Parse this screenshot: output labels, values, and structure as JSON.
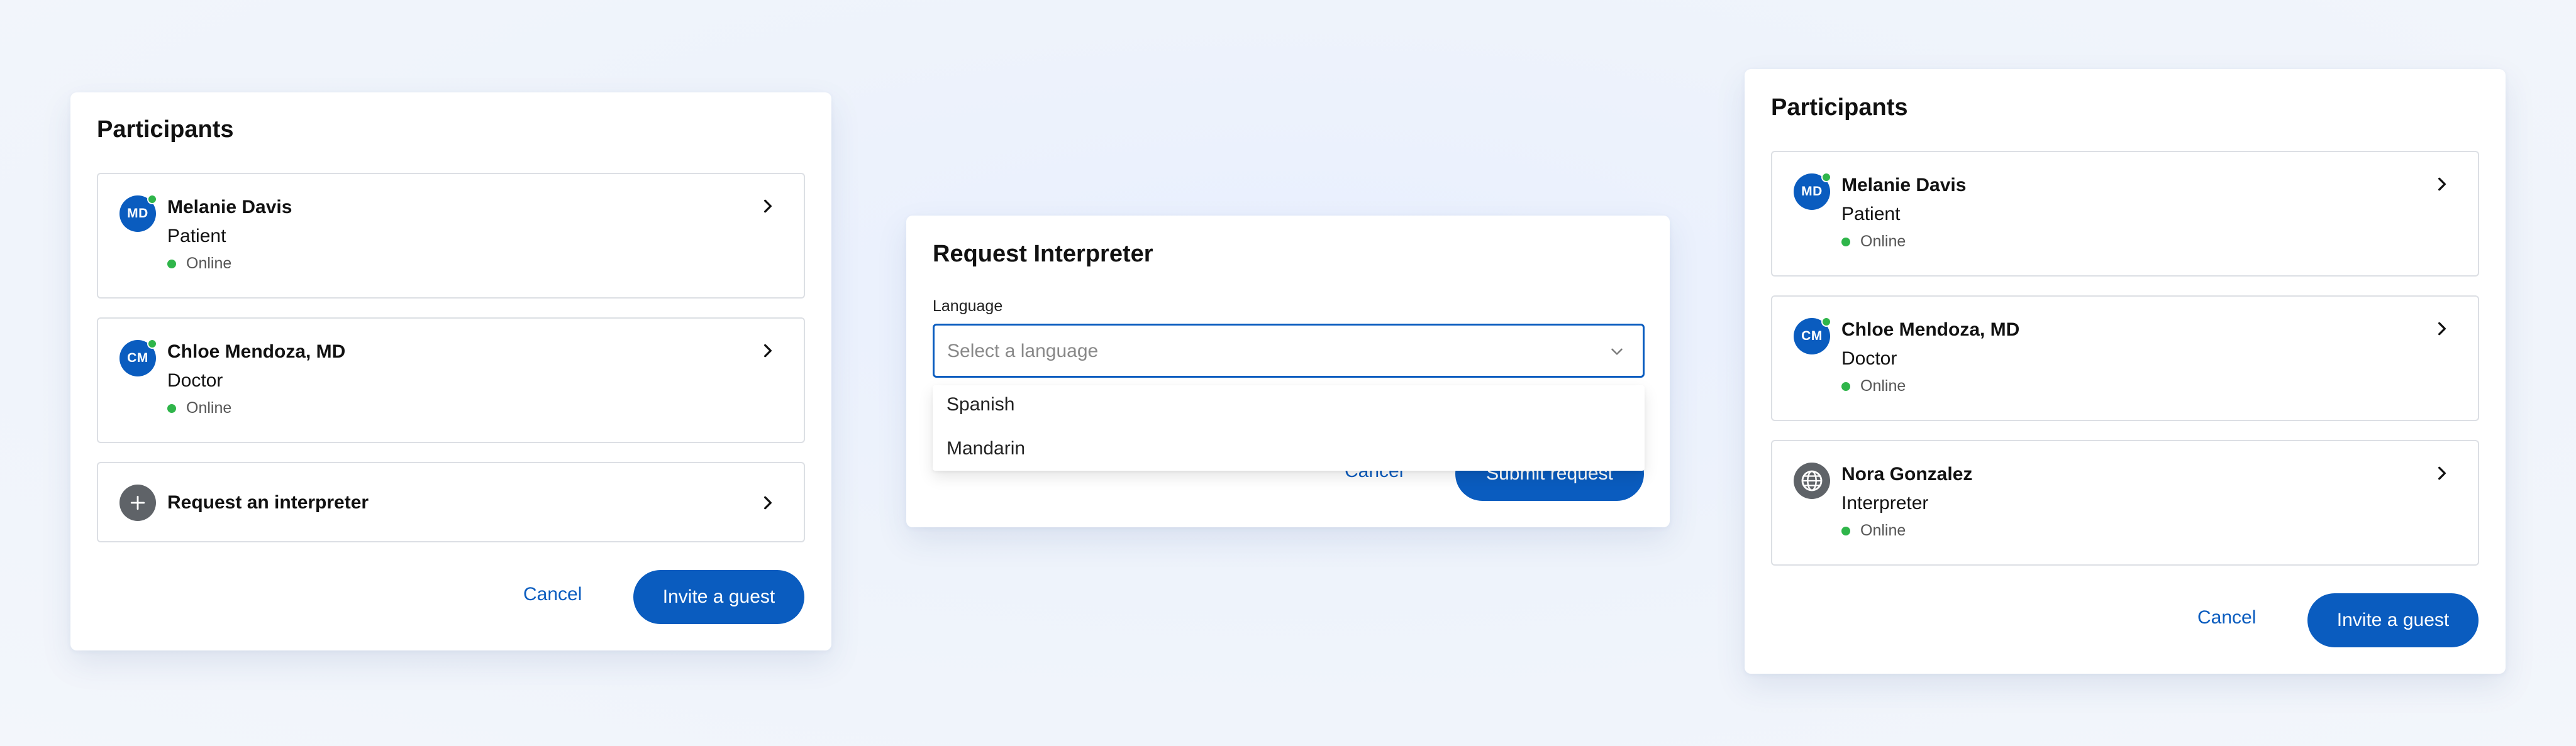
{
  "left_panel": {
    "title": "Participants",
    "participants": [
      {
        "initials": "MD",
        "name": "Melanie Davis",
        "role": "Patient",
        "status": "Online"
      },
      {
        "initials": "CM",
        "name": "Chloe Mendoza, MD",
        "role": "Doctor",
        "status": "Online"
      }
    ],
    "request_interpreter_label": "Request an interpreter",
    "cancel_label": "Cancel",
    "invite_label": "Invite a guest"
  },
  "middle_panel": {
    "title": "Request Interpreter",
    "language_label": "Language",
    "select_placeholder": "Select a language",
    "options": [
      "Spanish",
      "Mandarin"
    ],
    "cancel_label": "Cancel",
    "submit_label": "Submit request"
  },
  "right_panel": {
    "title": "Participants",
    "participants": [
      {
        "initials": "MD",
        "name": "Melanie Davis",
        "role": "Patient",
        "status": "Online"
      },
      {
        "initials": "CM",
        "name": "Chloe Mendoza, MD",
        "role": "Doctor",
        "status": "Online"
      },
      {
        "icon": "globe-icon",
        "name": "Nora Gonzalez",
        "role": "Interpreter",
        "status": "Online"
      }
    ],
    "cancel_label": "Cancel",
    "invite_label": "Invite a guest"
  },
  "colors": {
    "accent": "#0a5cbf",
    "online": "#2fb54a",
    "border": "#dcdfe4",
    "background": "#eef3fb"
  }
}
